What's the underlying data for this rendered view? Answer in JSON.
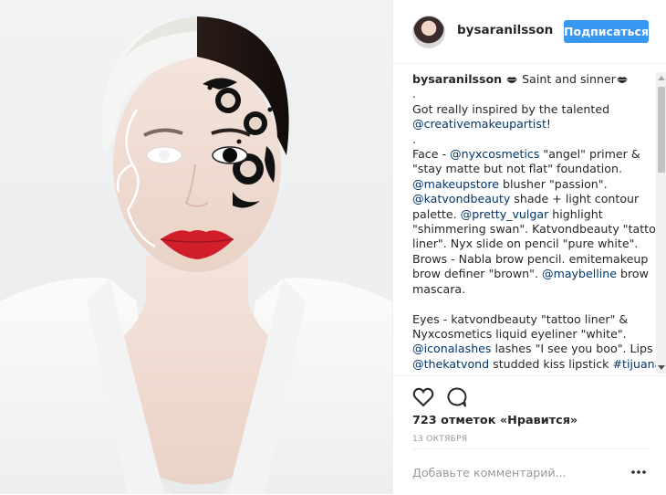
{
  "post": {
    "username": "bysaranilsson",
    "follow_label": "Подписаться",
    "caption": {
      "username": "bysaranilsson",
      "title": " Saint and sinner",
      "lines": [
        ".",
        "Got really inspired by the talented",
        "@creativemakeupartist!",
        ".",
        "Face - @nyxcosmetics \"angel\" primer &",
        "\"stay matte but not flat\" foundation.",
        "@makeupstore blusher \"passion\".",
        "@katvondbeauty shade + light contour",
        "palette. @pretty_vulgar highlight",
        "\"shimmering swan\". Katvondbeauty \"tattoo",
        "liner\". Nyx slide on pencil \"pure white\".",
        "Brows - Nabla brow pencil. emitemakeup",
        "brow definer \"brown\". @maybelline brow",
        "mascara.",
        "",
        "Eyes - katvondbeauty \"tattoo liner\" &",
        "Nyxcosmetics liquid eyeliner \"white\".",
        "@iconalashes lashes \"I see you boo\". Lips -",
        "@thekatvond studded kiss lipstick #tijuana ."
      ],
      "mentions": [
        "@creativemakeupartist!",
        "@nyxcosmetics",
        "@makeupstore",
        "@katvondbeauty",
        "@pretty_vulgar",
        "@maybelline",
        "@iconalashes",
        "@thekatvond",
        "#tijuana"
      ]
    },
    "likes_text": "723 отметок «Нравится»",
    "date_text": "13 ОКТЯБРЯ",
    "comment_placeholder": "Добавьте комментарий...",
    "icons": {
      "like": "heart-icon",
      "comment": "comment-icon",
      "more": "more-options-icon",
      "caption_emoji": "lips-emoji-icon"
    },
    "colors": {
      "accent": "#3897f0",
      "link": "#003569",
      "lips": "#d01e2a"
    }
  }
}
